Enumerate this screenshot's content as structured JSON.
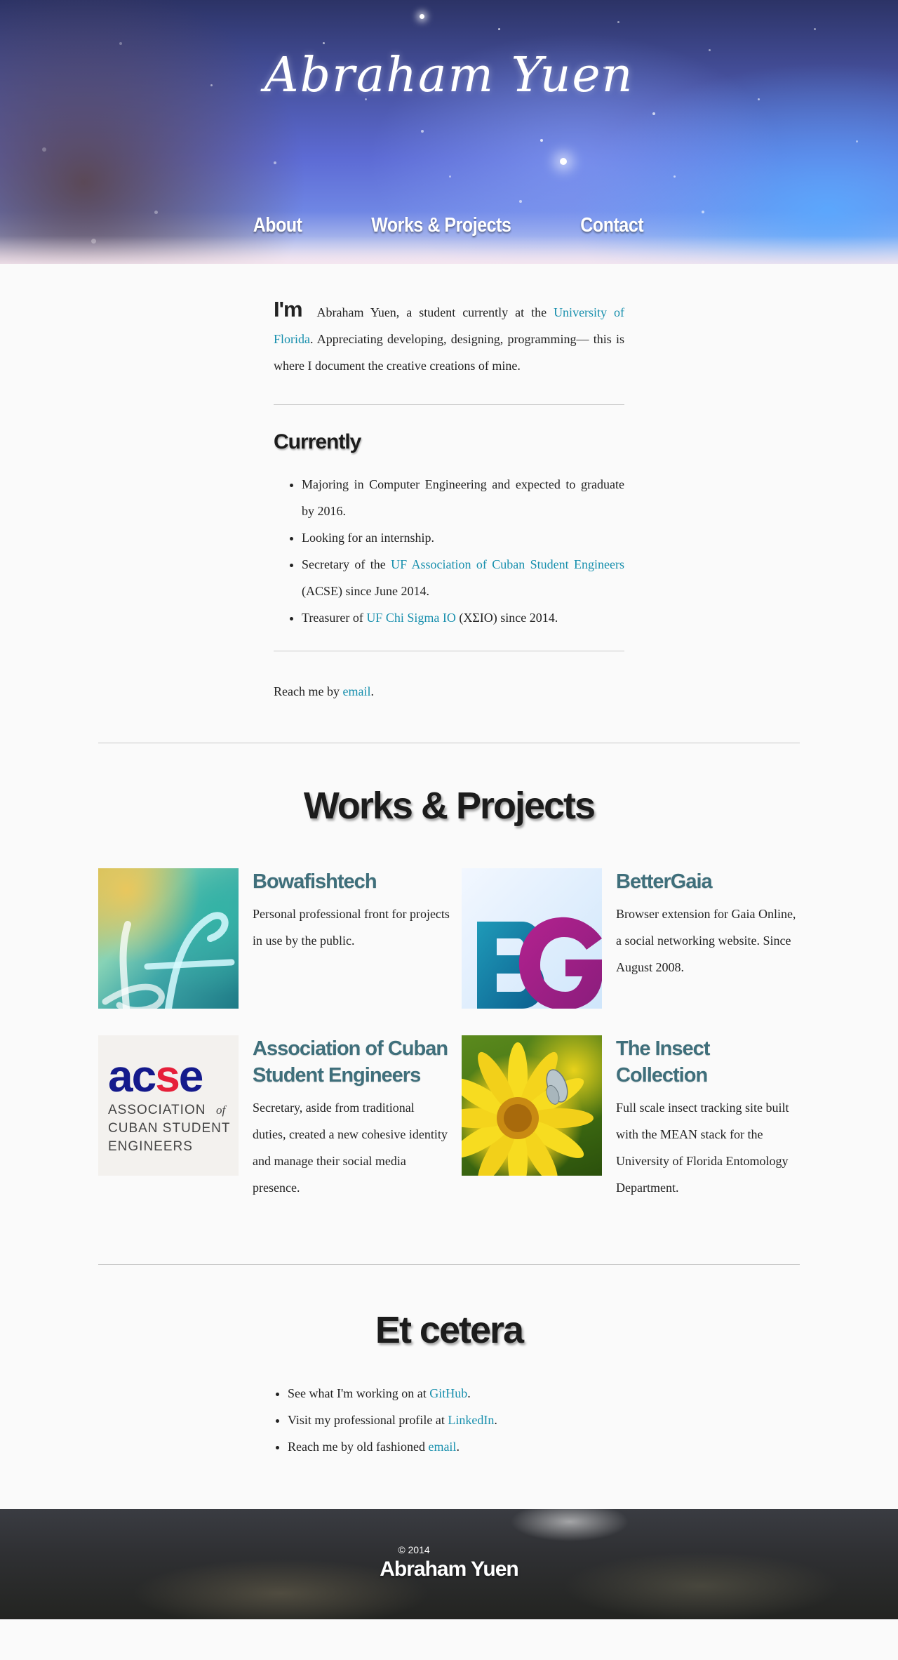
{
  "header": {
    "title": "Abraham Yuen",
    "nav": [
      "About",
      "Works & Projects",
      "Contact"
    ]
  },
  "about": {
    "im": "I'm",
    "intro_before": "Abraham Yuen, a student currently at the",
    "university_link": "University of Florida",
    "intro_after": ". Appreciating developing, designing, programming— this is where I document the creative creations of mine.",
    "currently_heading": "Currently",
    "currently": {
      "item1": "Majoring in Computer Engineering and expected to graduate by 2016.",
      "item2": "Looking for an internship.",
      "item3_before": "Secretary of the",
      "item3_link": "UF Association of Cuban Student Engineers",
      "item3_after": "(ACSE) since June 2014.",
      "item4_before": "Treasurer of",
      "item4_link": "UF Chi Sigma IO",
      "item4_after": "(ΧΣΙΟ) since 2014."
    },
    "reach_before": "Reach me by",
    "reach_link": "email",
    "reach_after": "."
  },
  "works": {
    "title": "Works & Projects",
    "projects": [
      {
        "title": "Bowafishtech",
        "description": "Personal professional front for projects in use by the public.",
        "thumb_icon": "bf-logo-icon"
      },
      {
        "title": "BetterGaia",
        "description": "Browser extension for Gaia Online, a social networking website. Since August 2008.",
        "thumb_icon": "bg-logo-icon"
      },
      {
        "title": "Association of Cuban Student Engineers",
        "description": "Secretary, aside from traditional duties, created a new cohesive identity and manage their social media presence.",
        "thumb_icon": "acse-logo-icon",
        "logo_text": {
          "mark": "acse",
          "line1": "ASSOCIATION",
          "of": "of",
          "line2": "CUBAN STUDENT",
          "line3": "ENGINEERS"
        }
      },
      {
        "title": "The Insect Collection",
        "description": "Full scale insect tracking site built with the MEAN stack for the University of Florida Entomology Department.",
        "thumb_icon": "flower-butterfly-photo"
      }
    ]
  },
  "etc": {
    "title": "Et cetera",
    "items": [
      {
        "before": "See what I'm working on at",
        "link": "GitHub",
        "after": "."
      },
      {
        "before": "Visit my professional profile at",
        "link": "LinkedIn",
        "after": "."
      },
      {
        "before": "Reach me by old fashioned",
        "link": "email",
        "after": "."
      }
    ]
  },
  "footer": {
    "copyright": "© 2014",
    "name": "Abraham Yuen"
  },
  "colors": {
    "link": "#178fad",
    "project_title": "#3f6f7b",
    "background": "#fafafa"
  }
}
